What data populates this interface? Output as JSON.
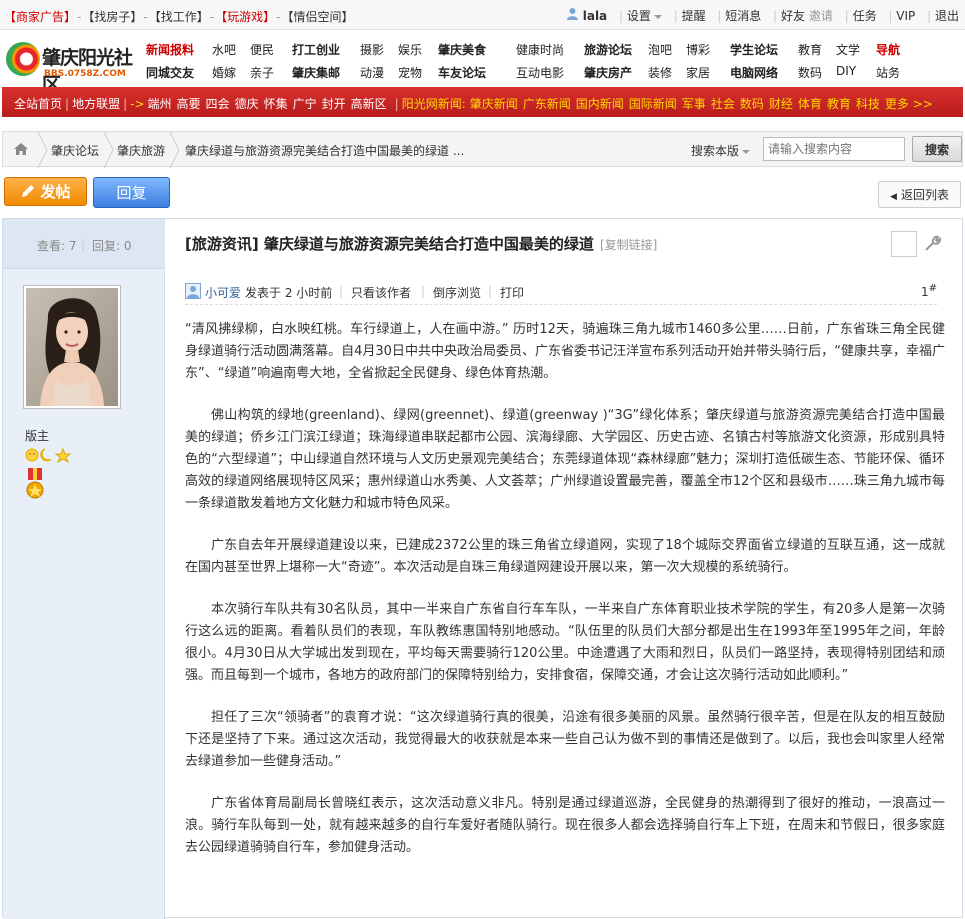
{
  "topbar": {
    "links": [
      {
        "label": "【商家广告】",
        "red": true
      },
      {
        "label": "【找房子】",
        "red": false
      },
      {
        "label": "【找工作】",
        "red": false
      },
      {
        "label": "【玩游戏】",
        "red": true
      },
      {
        "label": "【情侣空间】",
        "red": false
      }
    ],
    "username": "lala",
    "settings": "设置",
    "remind": "提醒",
    "messages": "短消息",
    "friends": "好友",
    "invite": "邀请",
    "tasks": "任务",
    "vip": "VIP",
    "logout": "退出"
  },
  "logo": {
    "name": "肇庆阳光社区",
    "url": "BBS.0758Z.COM"
  },
  "nav": {
    "row1": [
      {
        "label": "新闻报料",
        "style": "red"
      },
      {
        "label": "水吧",
        "style": ""
      },
      {
        "label": "便民",
        "style": ""
      },
      {
        "label": "打工创业",
        "style": "b"
      },
      {
        "label": "摄影",
        "style": ""
      },
      {
        "label": "娱乐",
        "style": ""
      },
      {
        "label": "肇庆美食",
        "style": "b"
      },
      {
        "label": "健康",
        "style": ""
      },
      {
        "label": "时尚",
        "style": ""
      },
      {
        "label": "旅游论坛",
        "style": "b"
      },
      {
        "label": "泡吧",
        "style": ""
      },
      {
        "label": "博彩",
        "style": ""
      },
      {
        "label": "学生论坛",
        "style": "b"
      },
      {
        "label": "教育",
        "style": ""
      },
      {
        "label": "文学",
        "style": ""
      },
      {
        "label": "导航",
        "style": "red"
      }
    ],
    "row2": [
      {
        "label": "同城交友",
        "style": "b"
      },
      {
        "label": "婚嫁",
        "style": ""
      },
      {
        "label": "亲子",
        "style": ""
      },
      {
        "label": "肇庆集邮",
        "style": "b"
      },
      {
        "label": "动漫",
        "style": ""
      },
      {
        "label": "宠物",
        "style": ""
      },
      {
        "label": "车友论坛",
        "style": "b"
      },
      {
        "label": "互动",
        "style": ""
      },
      {
        "label": "电影",
        "style": ""
      },
      {
        "label": "肇庆房产",
        "style": "b"
      },
      {
        "label": "装修",
        "style": ""
      },
      {
        "label": "家居",
        "style": ""
      },
      {
        "label": "电脑网络",
        "style": "b"
      },
      {
        "label": "数码",
        "style": ""
      },
      {
        "label": "DIY",
        "style": ""
      },
      {
        "label": "站务",
        "style": ""
      }
    ]
  },
  "redbar": {
    "left": [
      "全站首页",
      "地方联盟"
    ],
    "arrow": "->",
    "cities": [
      "端州",
      "高要",
      "四会",
      "德庆",
      "怀集",
      "广宁",
      "封开",
      "高新区"
    ],
    "sun_label": "阳光网新闻:",
    "news": [
      "肇庆新闻",
      "广东新闻",
      "国内新闻",
      "国际新闻",
      "军事",
      "社会",
      "数码",
      "财经",
      "体育",
      "教育",
      "科技",
      "更多 >>"
    ]
  },
  "breadcrumb": {
    "items": [
      "肇庆论坛",
      "肇庆旅游",
      "肇庆绿道与旅游资源完美结合打造中国最美的绿道 ..."
    ],
    "search_scope": "搜索本版",
    "search_placeholder": "请输入搜索内容",
    "search_button": "搜索"
  },
  "actions": {
    "post": "发帖",
    "reply": "回复",
    "back": "返回列表"
  },
  "stats": {
    "views_label": "查看:",
    "views": "7",
    "replies_label": "回复:",
    "replies": "0"
  },
  "author": {
    "rank": "版主"
  },
  "post": {
    "title": "[旅游资讯] 肇庆绿道与旅游资源完美结合打造中国最美的绿道",
    "copy_link": "[复制链接]",
    "author_name": "小可爱",
    "posted": "发表于 2 小时前",
    "only_author": "只看该作者",
    "reverse": "倒序浏览",
    "print": "打印",
    "floor": "1",
    "floor_sup": "#",
    "paragraphs": [
      "“清风拂绿柳，白水映红桃。车行绿道上，人在画中游。” 历时12天，骑遍珠三角九城市1460多公里……日前，广东省珠三角全民健身绿道骑行活动圆满落幕。自4月30日中共中央政治局委员、广东省委书记汪洋宣布系列活动开始并带头骑行后，“健康共享，幸福广东”、“绿道”响遍南粤大地，全省掀起全民健身、绿色体育热潮。",
      "佛山构筑的绿地(greenland)、绿网(greennet)、绿道(greenway )“3G”绿化体系；肇庆绿道与旅游资源完美结合打造中国最美的绿道；侨乡江门滨江绿道；珠海绿道串联起都市公园、滨海绿廊、大学园区、历史古迹、名镇古村等旅游文化资源，形成别具特色的“六型绿道”；中山绿道自然环境与人文历史景观完美结合；东莞绿道体现“森林绿廊”魅力；深圳打造低碳生态、节能环保、循环高效的绿道网络展现特区风采；惠州绿道山水秀美、人文荟萃；广州绿道设置最完善，覆盖全市12个区和县级市……珠三角九城市每一条绿道散发着地方文化魅力和城市特色风采。",
      "广东自去年开展绿道建设以来，已建成2372公里的珠三角省立绿道网，实现了18个城际交界面省立绿道的互联互通，这一成就在国内甚至世界上堪称一大“奇迹”。本次活动是自珠三角绿道网建设开展以来，第一次大规模的系统骑行。",
      "本次骑行车队共有30名队员，其中一半来自广东省自行车车队，一半来自广东体育职业技术学院的学生，有20多人是第一次骑行这么远的距离。看着队员们的表现，车队教练惠国特别地感动。“队伍里的队员们大部分都是出生在1993年至1995年之间，年龄很小。4月30日从大学城出发到现在，平均每天需要骑行120公里。中途遭遇了大雨和烈日，队员们一路坚持，表现得特别团结和顽强。而且每到一个城市，各地方的政府部门的保障特别给力，安排食宿，保障交通，才会让这次骑行活动如此顺利。”",
      "担任了三次“领骑者”的袁育才说：“这次绿道骑行真的很美，沿途有很多美丽的风景。虽然骑行很辛苦，但是在队友的相互鼓励下还是坚持了下来。通过这次活动，我觉得最大的收获就是本来一些自己认为做不到的事情还是做到了。以后，我也会叫家里人经常去绿道参加一些健身活动。”",
      "广东省体育局副局长曾晓红表示，这次活动意义非凡。特别是通过绿道巡游，全民健身的热潮得到了很好的推动，一浪高过一浪。骑行车队每到一处，就有越来越多的自行车爱好者随队骑行。现在很多人都会选择骑自行车上下班，在周末和节假日，很多家庭去公园绿道骑骑自行车，参加健身活动。"
    ]
  }
}
